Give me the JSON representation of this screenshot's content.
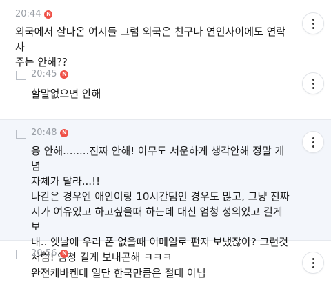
{
  "comments": [
    {
      "time": "20:44",
      "badge": "N",
      "text": "외국에서 살다온 여시들 그럼 외국은 친구나 연인사이에도 연락 자\n주는 안해??"
    },
    {
      "time": "20:45",
      "badge": "N",
      "text": "할말없으면 안해"
    },
    {
      "time": "20:48",
      "badge": "N",
      "text": "응 안해........진짜 안해! 아무도 서운하게 생각안해 정말 개념\n자체가 달라...!!\n나같은 경우엔 애인이랑 10시간텀인 경우도 많고, 그냥 진짜\n지가 여유있고 하고싶을때 하는데 대신 엄청 성의있고 길게 보\n내.. 옛날에 우리 폰 없을때 이메일로 편지 보냈잖아? 그런것\n처럼! 엄청 길게 보내곤해 ㅋㅋㅋ"
    },
    {
      "time": "20:56",
      "badge": "N",
      "text": "완전케바켄데 일단 한국만큼은 절대 아님"
    }
  ],
  "colors": {
    "badge": "#ef5147",
    "highlight_bg": "#f3f6fb",
    "timestamp": "#9a9fa6"
  },
  "icons": {
    "more": "vertical-ellipsis-icon",
    "reply": "reply-corner-icon"
  }
}
